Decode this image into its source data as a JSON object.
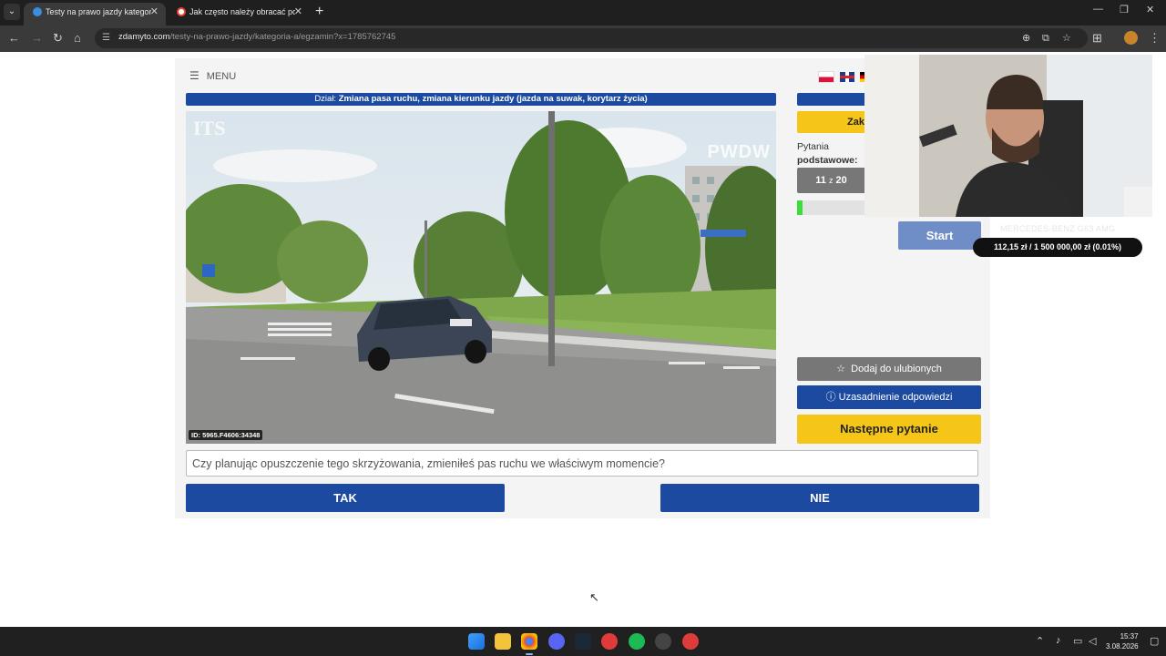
{
  "browser": {
    "tabs": [
      {
        "title": "Testy na prawo jazdy kategoria",
        "active": true,
        "favicon_color": "#3b8de0"
      },
      {
        "title": "Jak często należy obracać pozi",
        "active": false,
        "favicon_color": "#ffffff"
      }
    ],
    "url_host": "zdamyto.com",
    "url_path": "/testy-na-prawo-jazdy/kategoria-a/egzamin?x=1785762745"
  },
  "exam": {
    "menu_label": "MENU",
    "section_prefix": "Dział:",
    "section_name": "Zmiana pasa ruchu, zmiana kierunku jazdy (jazda na suwak, korytarz życia)",
    "media_id": "ID: 5965.F4606:34348",
    "watermark_left": "ITS",
    "watermark_right": "PWDW",
    "question": "Czy planując opuszczenie tego skrzyżowania, zmieniłeś pas ruchu we właściwym momencie?",
    "answer_yes": "TAK",
    "answer_no": "NIE",
    "end_button": "Zak",
    "q_label_top": "Pytania",
    "q_label_bottom": "podstawowe:",
    "q_current": "11",
    "q_sep": "z",
    "q_total": "20",
    "progress_fraction": 0.08,
    "fav_button": "Dodaj do ulubionych",
    "justify_button": "Uzasadnienie odpowiedzi",
    "next_button": "Następne pytanie"
  },
  "overlay": {
    "start_button": "Start",
    "car_label": "MERCEDES-BENZ G63 AMG",
    "goal": "112,15 zł / 1 500 000,00 zł (0.01%)"
  },
  "system": {
    "time": "15:37",
    "date": "3.08.2026"
  },
  "colors": {
    "primary_blue": "#1c4aa0",
    "yellow": "#f5c518",
    "progress_green": "#3ddc3d"
  }
}
